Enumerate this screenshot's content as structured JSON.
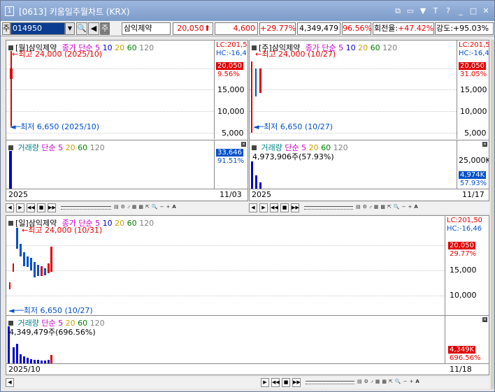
{
  "window": {
    "number": "1",
    "title": "[0613] 키움일주월차트 (KRX)"
  },
  "titlebar_icons": [
    "restore-icon",
    "tile-icon",
    "pin-icon",
    "text-icon",
    "help-icon",
    "minimize-icon",
    "maximize-icon",
    "close-icon"
  ],
  "toolbar": {
    "market": "주",
    "code": "014950",
    "search_label": "Q",
    "prev_label": "◀",
    "name_prefix": "주",
    "stock_name": "삼익제약",
    "price": "20,050",
    "arrow": "⬆",
    "change": "4,600",
    "change_pct": "+29.77%",
    "volume": "4,349,479",
    "vol_ratio": "96.56%",
    "turnover_label": "회전율:",
    "turnover": "+47.42%",
    "strength_label": "강도:",
    "strength": "+95.03%"
  },
  "panels": {
    "monthly": {
      "title": "[월]삼익제약",
      "ma_label": "종가 단순",
      "ma5": "5",
      "ma10": "10",
      "ma20": "20",
      "ma60": "60",
      "ma120": "120",
      "high": "최고 24,000 (2025/10)",
      "low": "최저 6,650 (2025/10)",
      "lc": "LC:201,5",
      "hc": "HC:-16,4",
      "price_tag": "20,050",
      "pct_tag": "9.56%",
      "ticks": [
        "15,000",
        "10,000",
        "5,000"
      ],
      "vol_title": "거래량",
      "vol_ma": "단순",
      "vol5": "5",
      "vol20": "20",
      "vol60": "60",
      "vol120": "120",
      "vol_tag": "33,646",
      "vol_pct_tag": "91.51%",
      "date_left": "2025",
      "date_right": "11/03"
    },
    "weekly": {
      "title": "[주]삼익제약",
      "ma_label": "종가 단순",
      "ma5": "5",
      "ma10": "10",
      "ma20": "20",
      "ma60": "60",
      "ma120": "120",
      "high": "최고 24,000 (10/27)",
      "low": "최저 6,650 (10/27)",
      "lc": "LC:201,5",
      "hc": "HC:-16,4",
      "price_tag": "20,050",
      "pct_tag": "31.05%",
      "ticks": [
        "15,000",
        "10,000",
        "5,000"
      ],
      "vol_title": "거래량",
      "vol_ma": "단순",
      "vol5": "5",
      "vol20": "20",
      "vol60": "60",
      "vol120": "120",
      "vol_value": "4,973,906주(57.93%)",
      "vol_tick": "25,000K",
      "vol_tag": "4,974K",
      "vol_pct_tag": "57.93%",
      "date_left": "2025",
      "date_right": "11/17"
    },
    "daily": {
      "title": "[일]삼익제약",
      "ma_label": "종가 단순",
      "ma5": "5",
      "ma10": "10",
      "ma20": "20",
      "ma60": "60",
      "ma120": "120",
      "high": "최고 24,000 (10/31)",
      "low": "최저 6,650 (10/27)",
      "lc": "LC:201,50",
      "hc": "HC:-16,46",
      "price_tag": "20,050",
      "pct_tag": "29.77%",
      "ticks": [
        "15,000",
        "10,000"
      ],
      "vol_title": "거래량",
      "vol_ma": "단순",
      "vol5": "5",
      "vol20": "20",
      "vol60": "60",
      "vol120": "120",
      "vol_value": "4,349,479주(696.56%)",
      "vol_tag": "4,349K",
      "vol_pct_tag": "696.56%",
      "date_left": "2025/10",
      "date_right": "11/18"
    }
  },
  "navbar": {
    "buttons": [
      "◀",
      "▶",
      "◀◀",
      "■",
      "▶▶"
    ],
    "tools": [
      "calc-icon",
      "gear-icon",
      "indicator-icon",
      "table-icon",
      "grid-icon",
      "cursor-icon",
      "zoom-icon"
    ],
    "minus": "−",
    "plus": "+",
    "text": "A"
  },
  "colors": {
    "up": "#e60000",
    "down": "#0050c8",
    "ma5": "#cc00cc",
    "ma10": "#0000cc",
    "ma20": "#c8a000",
    "ma60": "#008000",
    "ma120": "#808080",
    "vol": "#0000d0"
  }
}
